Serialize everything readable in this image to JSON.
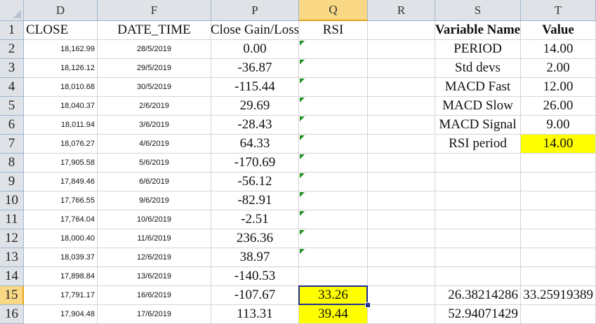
{
  "columns": [
    "D",
    "F",
    "P",
    "Q",
    "R",
    "S",
    "T"
  ],
  "selected_column": "Q",
  "rows": [
    "1",
    "2",
    "3",
    "4",
    "5",
    "6",
    "7",
    "8",
    "9",
    "10",
    "11",
    "12",
    "13",
    "14",
    "15",
    "16"
  ],
  "selected_row": "15",
  "headers": {
    "close": "CLOSE",
    "date_time": "DATE_TIME",
    "close_gain_loss": "Close Gain/Loss",
    "rsi": "RSI",
    "variable_name": "Variable Name",
    "value": "Value"
  },
  "close": [
    "18,162.99",
    "18,126.12",
    "18,010.68",
    "18,040.37",
    "18,011.94",
    "18,076.27",
    "17,905.58",
    "17,849.46",
    "17,766.55",
    "17,764.04",
    "18,000.40",
    "18,039.37",
    "17,898.84",
    "17,791.17",
    "17,904.48"
  ],
  "dates": [
    "28/5/2019",
    "29/5/2019",
    "30/5/2019",
    "2/6/2019",
    "3/6/2019",
    "4/6/2019",
    "5/6/2019",
    "6/6/2019",
    "9/6/2019",
    "10/6/2019",
    "11/6/2019",
    "12/6/2019",
    "13/6/2019",
    "16/6/2019",
    "17/6/2019"
  ],
  "gain_loss": [
    "0.00",
    "-36.87",
    "-115.44",
    "29.69",
    "-28.43",
    "64.33",
    "-170.69",
    "-56.12",
    "-82.91",
    "-2.51",
    "236.36",
    "38.97",
    "-140.53",
    "-107.67",
    "113.31"
  ],
  "rsi_values": {
    "row15": "33.26",
    "row16": "39.44"
  },
  "variables": [
    {
      "name": "PERIOD",
      "value": "14.00"
    },
    {
      "name": "Std devs",
      "value": "2.00"
    },
    {
      "name": "MACD Fast",
      "value": "12.00"
    },
    {
      "name": "MACD Slow",
      "value": "26.00"
    },
    {
      "name": "MACD Signal",
      "value": "9.00"
    },
    {
      "name": "RSI period",
      "value": "14.00"
    }
  ],
  "extra": {
    "s15": "26.38214286",
    "t15": "33.25919389",
    "s16": "52.94071429"
  },
  "colors": {
    "highlight": "#ffff00",
    "header_bg": "#dfe3e8",
    "selected_header": "#f8d885",
    "active_border": "#1f2f8f",
    "error_triangle": "#1f8f1f"
  }
}
